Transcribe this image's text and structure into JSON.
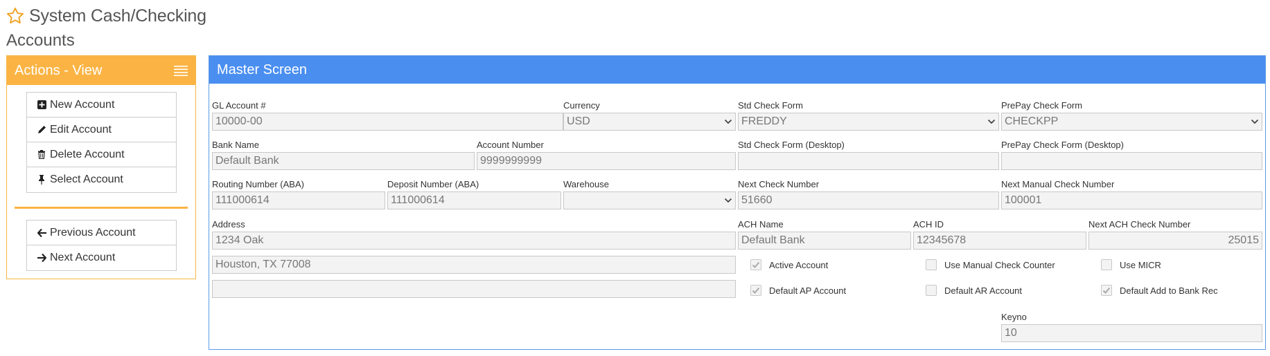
{
  "title": "System Cash/Checking",
  "subtitle": "Accounts",
  "actions": {
    "header": "Actions - View",
    "group1": [
      "New Account",
      "Edit Account",
      "Delete Account",
      "Select Account"
    ],
    "group2": [
      "Previous Account",
      "Next Account"
    ]
  },
  "master": {
    "header": "Master Screen",
    "labels": {
      "gl_account": "GL Account #",
      "currency": "Currency",
      "std_check_form": "Std Check Form",
      "prepay_check_form": "PrePay Check Form",
      "bank_name": "Bank Name",
      "account_number": "Account Number",
      "std_check_form_desktop": "Std Check Form (Desktop)",
      "prepay_check_form_desktop": "PrePay Check Form (Desktop)",
      "routing_number": "Routing Number (ABA)",
      "deposit_number": "Deposit Number (ABA)",
      "warehouse": "Warehouse",
      "next_check_number": "Next Check Number",
      "next_manual_check_number": "Next Manual Check Number",
      "address": "Address",
      "ach_name": "ACH Name",
      "ach_id": "ACH ID",
      "next_ach_check_number": "Next ACH Check Number",
      "keyno": "Keyno"
    },
    "values": {
      "gl_account": "10000-00",
      "currency": "USD",
      "std_check_form": "FREDDY",
      "prepay_check_form": "CHECKPP",
      "bank_name": "Default Bank",
      "account_number": "9999999999",
      "std_check_form_desktop": "",
      "prepay_check_form_desktop": "",
      "routing_number": "111000614",
      "deposit_number": "111000614",
      "warehouse": "",
      "next_check_number": "51660",
      "next_manual_check_number": "100001",
      "address1": "1234 Oak",
      "address2": "Houston, TX 77008",
      "address3": "",
      "ach_name": "Default Bank",
      "ach_id": "12345678",
      "next_ach_check_number": "25015",
      "keyno": "10"
    },
    "checkboxes": {
      "active_account": {
        "label": "Active Account",
        "checked": true
      },
      "use_manual_check_counter": {
        "label": "Use Manual Check Counter",
        "checked": false
      },
      "use_micr": {
        "label": "Use MICR",
        "checked": false
      },
      "default_ap_account": {
        "label": "Default AP Account",
        "checked": true
      },
      "default_ar_account": {
        "label": "Default AR Account",
        "checked": false
      },
      "default_add_to_bank_rec": {
        "label": "Default Add to Bank Rec",
        "checked": true
      }
    }
  },
  "colors": {
    "actions_accent": "#fbb444",
    "master_accent": "#4a8ef0"
  }
}
